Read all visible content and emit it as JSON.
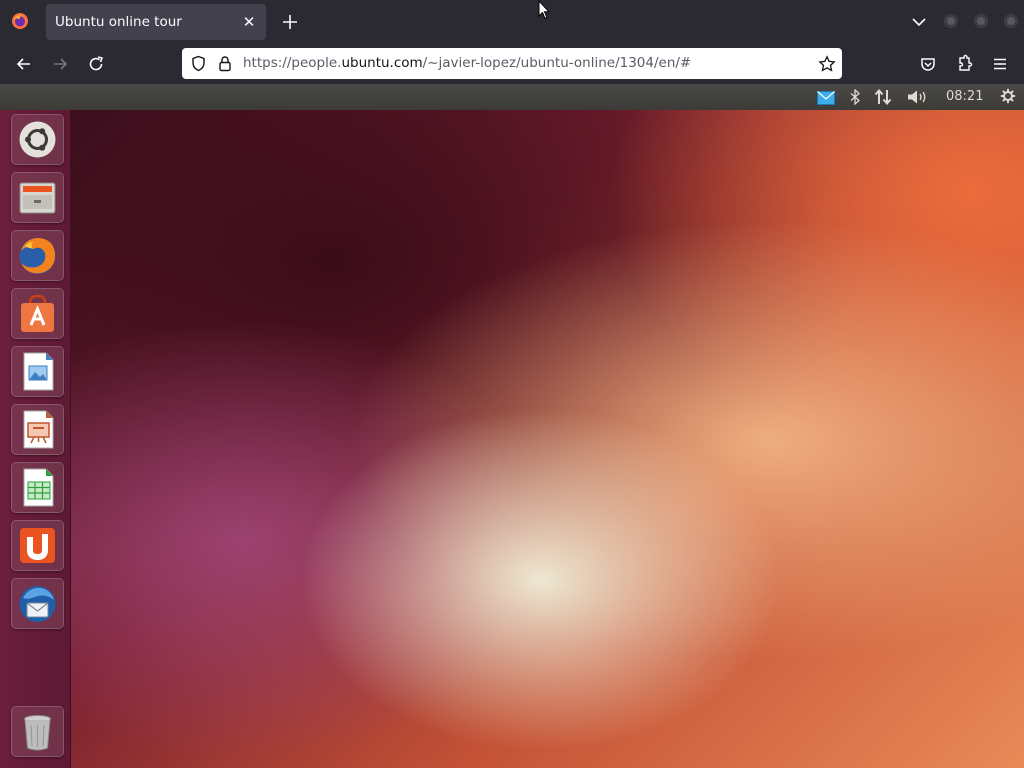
{
  "browser": {
    "tab_title": "Ubuntu online tour",
    "url": "https://people.ubuntu.com/~javier-lopez/ubuntu-online/1304/en/#",
    "url_prefix": "https://people.",
    "url_domain": "ubuntu.com",
    "url_path": "/~javier-lopez/ubuntu-online/1304/en/#"
  },
  "ubuntu_panel": {
    "clock": "08:21",
    "indicators": [
      "mail-icon",
      "bluetooth-icon",
      "network-icon",
      "volume-icon",
      "settings-gear-icon"
    ]
  },
  "launcher": {
    "items": [
      {
        "name": "ubuntu-dash-icon"
      },
      {
        "name": "files-icon"
      },
      {
        "name": "firefox-icon"
      },
      {
        "name": "software-center-icon"
      },
      {
        "name": "libreoffice-writer-icon"
      },
      {
        "name": "libreoffice-impress-icon"
      },
      {
        "name": "libreoffice-calc-icon"
      },
      {
        "name": "ubuntu-one-icon"
      },
      {
        "name": "thunderbird-icon"
      },
      {
        "name": "trash-icon"
      }
    ]
  },
  "colors": {
    "browser_chrome": "#2b2a33",
    "tab_active": "#42414d",
    "launcher": "#6b1e3a",
    "panel": "#3c3b37",
    "accent_orange": "#e95420"
  }
}
